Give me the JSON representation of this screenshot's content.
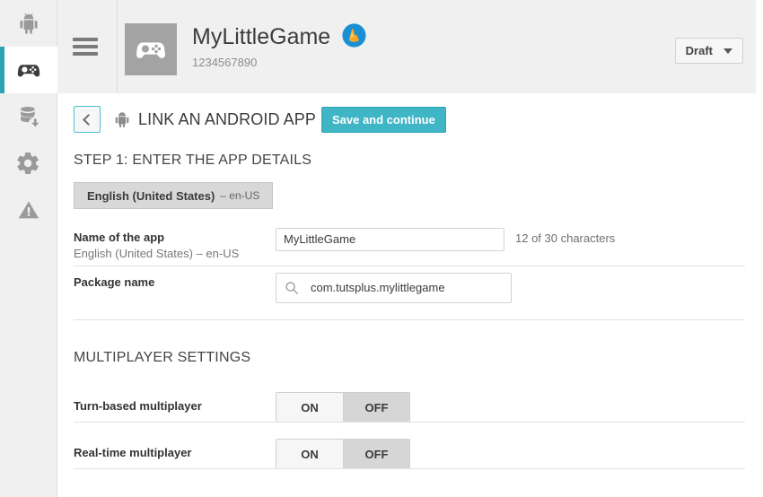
{
  "sidebar": {
    "items": [
      {
        "icon": "android-robot-icon",
        "name": "sidebar-item-android",
        "active": false
      },
      {
        "icon": "gamepad-icon",
        "name": "sidebar-item-games",
        "active": true
      },
      {
        "icon": "database-download-icon",
        "name": "sidebar-item-database",
        "active": false
      },
      {
        "icon": "gear-icon",
        "name": "sidebar-item-settings",
        "active": false
      },
      {
        "icon": "warning-triangle-icon",
        "name": "sidebar-item-alerts",
        "active": false
      }
    ]
  },
  "header": {
    "menu_icon": "hamburger-icon",
    "app_icon": "gamepad-icon",
    "title": "MyLittleGame",
    "badge_icon": "firebase-flame-icon",
    "app_id": "1234567890",
    "status": {
      "label": "Draft",
      "caret_icon": "chevron-down-icon"
    }
  },
  "breadcrumb": {
    "back_icon": "chevron-left-icon",
    "platform_icon": "android-robot-icon",
    "title": "LINK AN ANDROID APP",
    "save_label": "Save and continue"
  },
  "step1": {
    "heading": "STEP 1: ENTER THE APP DETAILS",
    "language_tab": {
      "name": "English (United States)",
      "code": "– en-US"
    },
    "fields": [
      {
        "label": "Name of the app",
        "sublabel": "English (United States) – en-US",
        "value": "MyLittleGame",
        "placeholder": "Name of the app",
        "counter": "12 of 30 characters"
      },
      {
        "label": "Package name",
        "value": "com.tutsplus.mylittlegame",
        "placeholder": "Package name",
        "search_icon": "search-icon"
      }
    ]
  },
  "multiplayer": {
    "heading": "MULTIPLAYER SETTINGS",
    "settings": [
      {
        "label": "Turn-based multiplayer",
        "options": [
          "ON",
          "OFF"
        ],
        "selected": "OFF"
      },
      {
        "label": "Real-time multiplayer",
        "options": [
          "ON",
          "OFF"
        ],
        "selected": "OFF"
      }
    ]
  },
  "colors": {
    "accent_teal": "#3fb5c6",
    "sidebar_bg": "#f0f0f0",
    "header_bg": "#f0f0f0",
    "firebase_blue": "#1a8fd4",
    "firebase_flame": "#f5a623"
  }
}
